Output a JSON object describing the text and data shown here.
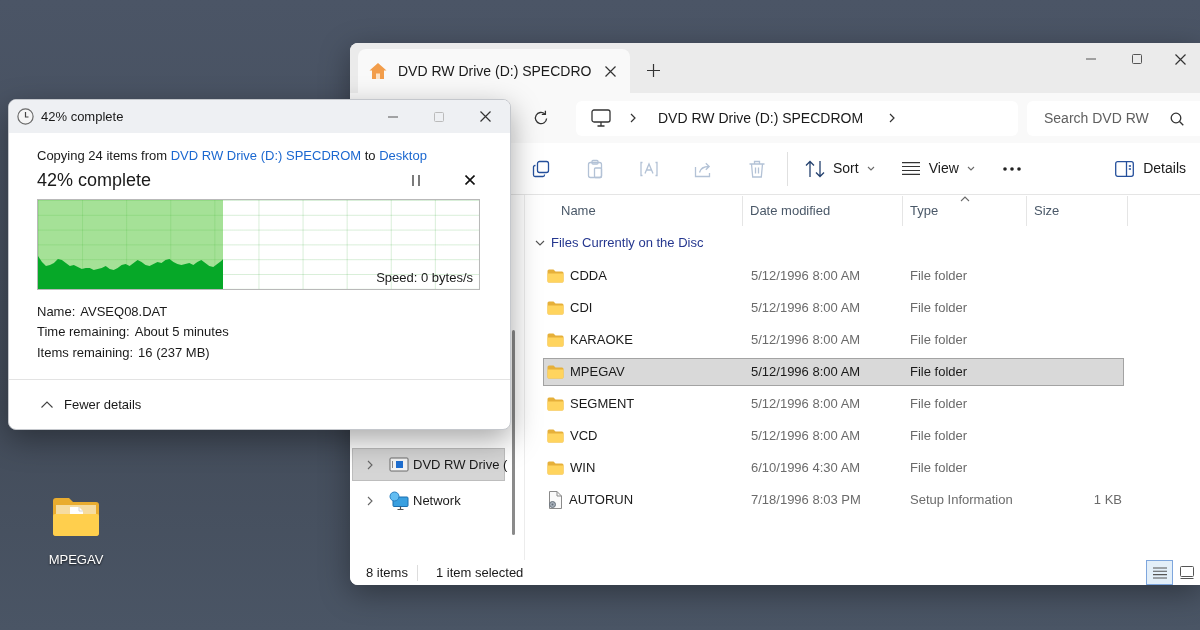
{
  "explorer": {
    "tabs": [
      {
        "label": "DVD RW Drive (D:) SPECDRO",
        "selected": true
      }
    ],
    "address": {
      "path": [
        "DVD RW Drive (D:) SPECDROM"
      ]
    },
    "search": {
      "placeholder": "Search DVD RW"
    },
    "toolbar": {
      "actions": [
        {
          "disabled": false
        },
        {
          "disabled": true
        },
        {
          "disabled": true
        },
        {
          "disabled": true
        },
        {
          "disabled": true
        }
      ],
      "sort": "Sort",
      "view": "View",
      "details": "Details"
    },
    "nav": [
      {
        "kind": "drive",
        "label": "DVD RW Drive (",
        "selected": true
      },
      {
        "kind": "network",
        "label": "Network",
        "selected": false
      }
    ],
    "columns": [
      {
        "label": "Name",
        "sorted": false
      },
      {
        "label": "Date modified",
        "sorted": false
      },
      {
        "label": "Type",
        "sorted": true
      },
      {
        "label": "Size",
        "sorted": false
      }
    ],
    "groups": [
      {
        "label": "Files Currently on the Disc",
        "expanded": true,
        "rows": [
          {
            "kind": "folder",
            "name": "CDDA",
            "date": "5/12/1996 8:00 AM",
            "type": "File folder",
            "selected": false
          },
          {
            "kind": "folder",
            "name": "CDI",
            "date": "5/12/1996 8:00 AM",
            "type": "File folder",
            "selected": false
          },
          {
            "kind": "folder",
            "name": "KARAOKE",
            "date": "5/12/1996 8:00 AM",
            "type": "File folder",
            "selected": false
          },
          {
            "kind": "folder",
            "name": "MPEGAV",
            "date": "5/12/1996 8:00 AM",
            "type": "File folder",
            "selected": true
          },
          {
            "kind": "folder",
            "name": "SEGMENT",
            "date": "5/12/1996 8:00 AM",
            "type": "File folder",
            "selected": false
          },
          {
            "kind": "folder",
            "name": "VCD",
            "date": "5/12/1996 8:00 AM",
            "type": "File folder",
            "selected": false
          },
          {
            "kind": "folder",
            "name": "WIN",
            "date": "6/10/1996 4:30 AM",
            "type": "File folder",
            "selected": false
          },
          {
            "kind": "file",
            "name": "AUTORUN",
            "date": "7/18/1996 8:03 PM",
            "type": "Setup Information",
            "size": "1 KB",
            "selected": false
          }
        ]
      }
    ],
    "status_bar": {
      "count": "8 items",
      "selection": "1 item selected"
    },
    "views": [
      {
        "selected": true
      },
      {
        "selected": false
      }
    ]
  },
  "copy_dialog": {
    "title": "42% complete",
    "summary": [
      {
        "kind": "text",
        "text": "Copying 24 items from "
      },
      {
        "kind": "link",
        "text": "DVD RW Drive (D:) SPECDROM"
      },
      {
        "kind": "text",
        "text": " to "
      },
      {
        "kind": "link",
        "text": "Desktop"
      }
    ],
    "heading": "42% complete",
    "progress": {
      "level": 0.42,
      "speed": "Speed: 0 bytes/s"
    },
    "details": [
      {
        "label": "Name:",
        "value": "AVSEQ08.DAT"
      },
      {
        "label": "Time remaining:",
        "value": "About 5 minutes"
      },
      {
        "label": "Items remaining:",
        "value": "16 (237 MB)"
      }
    ],
    "toggle": {
      "label": "Fewer details",
      "expanded": true
    }
  },
  "desktop": {
    "icons": [
      {
        "label": "MPEGAV"
      }
    ]
  }
}
